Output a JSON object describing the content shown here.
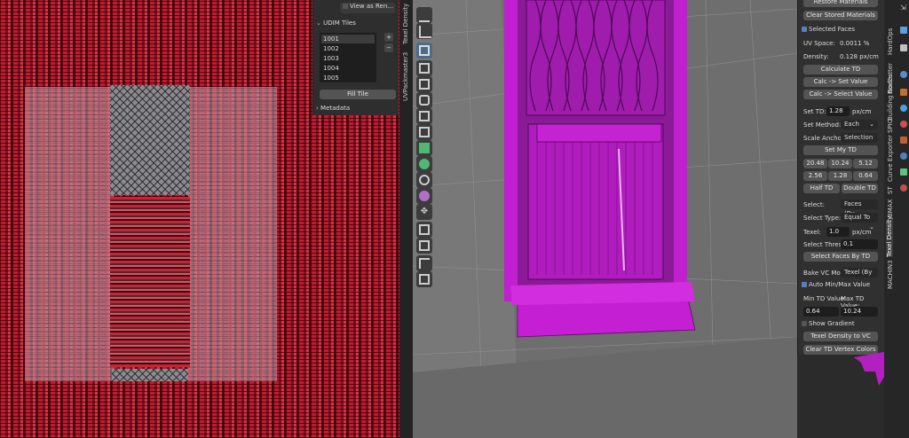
{
  "udim_panel": {
    "view_as_render": "View as Ren...",
    "header": "UDIM Tiles",
    "tiles": [
      "1001",
      "1002",
      "1003",
      "1004",
      "1005"
    ],
    "fill_tile": "Fill Tile",
    "metadata": "Metadata"
  },
  "side_tab_uv": "UVPackmaster3",
  "side_tab_td": "Texel Density",
  "td_panel": {
    "restore_materials": "Restore Materials",
    "clear_stored_materials": "Clear Stored Materials",
    "selected_faces": "Selected Faces",
    "uv_space_label": "UV Space:",
    "uv_space_value": "0.0011 %",
    "density_label": "Density:",
    "density_value": "0.128 px/cm",
    "calculate_td": "Calculate TD",
    "calc_set_value": "Calc -> Set Value",
    "calc_select_value": "Calc -> Select Value",
    "set_td_label": "Set TD:",
    "set_td_value": "1.28",
    "set_td_unit": "px/cm",
    "set_method_label": "Set Method:",
    "set_method_value": "Each",
    "scale_anchor_label": "Scale Anchor:",
    "scale_anchor_value": "Selection",
    "set_my_td": "Set My TD",
    "presets": [
      "20.48",
      "10.24",
      "5.12",
      "2.56",
      "1.28",
      "0.64"
    ],
    "half_td": "Half TD",
    "double_td": "Double TD",
    "select_label": "Select:",
    "select_value": "Faces (By...",
    "select_type_label": "Select Type:",
    "select_type_value": "Equal To",
    "texel_label": "Texel:",
    "texel_value": "1.0",
    "texel_unit": "px/cm",
    "select_thresh_label": "Select Thresh",
    "select_thresh_value": "0.1",
    "select_faces_by_td": "Select Faces By TD",
    "bake_vc_label": "Bake VC Mod...",
    "bake_vc_value": "Texel (By",
    "auto_min_max": "Auto Min/Max Value",
    "min_td_label": "Min TD Value:",
    "max_td_label": "Max TD Value:",
    "min_td_value": "0.64",
    "max_td_value": "10.24",
    "show_gradient": "Show Gradient",
    "texel_density_to_vc": "Texel Density to VC",
    "clear_td_vertex_colors": "Clear TD Vertex Colors"
  },
  "right_tabs": [
    "HardOps",
    "BoxCutter",
    "Building Nodes",
    "SPIO",
    "Curve Exporter",
    "ST",
    "BMAX",
    "Texel Density",
    "MACHIN3"
  ],
  "colors": {
    "panel_bg": "#303030",
    "button": "#545454",
    "field": "#1d1d1d",
    "checkbox": "#5680c2",
    "mesh_magenta": "#c21fd0"
  }
}
